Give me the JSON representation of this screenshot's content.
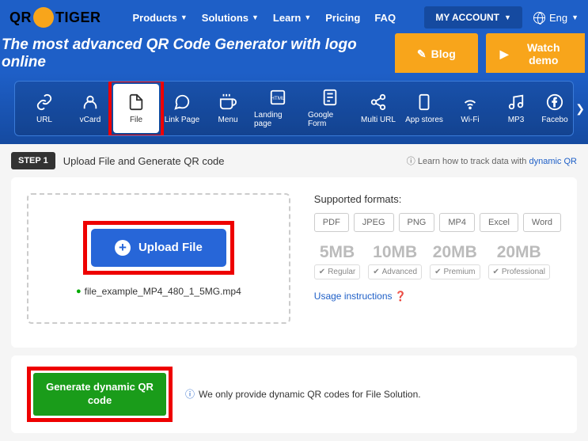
{
  "logo": {
    "pre": "QR",
    "post": "TIGER"
  },
  "nav": [
    "Products",
    "Solutions",
    "Learn",
    "Pricing",
    "FAQ"
  ],
  "account": "MY ACCOUNT",
  "lang": "Eng",
  "hero": {
    "title": "The most advanced QR Code Generator with logo online",
    "blog": "Blog",
    "demo": "Watch demo"
  },
  "tabs": [
    "URL",
    "vCard",
    "File",
    "Link Page",
    "Menu",
    "Landing page",
    "Google Form",
    "Multi URL",
    "App stores",
    "Wi-Fi",
    "MP3",
    "Facebo"
  ],
  "step": {
    "badge": "STEP 1",
    "text": "Upload File and Generate QR code"
  },
  "learn": {
    "pre": "Learn how to track data with ",
    "link": "dynamic QR"
  },
  "upload": {
    "btn": "Upload File",
    "filename": "file_example_MP4_480_1_5MG.mp4"
  },
  "supported": {
    "title": "Supported formats:",
    "formats": [
      "PDF",
      "JPEG",
      "PNG",
      "MP4",
      "Excel",
      "Word"
    ]
  },
  "sizes": [
    {
      "val": "5MB",
      "lbl": "Regular"
    },
    {
      "val": "10MB",
      "lbl": "Advanced"
    },
    {
      "val": "20MB",
      "lbl": "Premium"
    },
    {
      "val": "20MB",
      "lbl": "Professional"
    }
  ],
  "usage": "Usage instructions",
  "generate": {
    "btn": "Generate dynamic QR code",
    "info": "We only provide dynamic QR codes for File Solution."
  }
}
